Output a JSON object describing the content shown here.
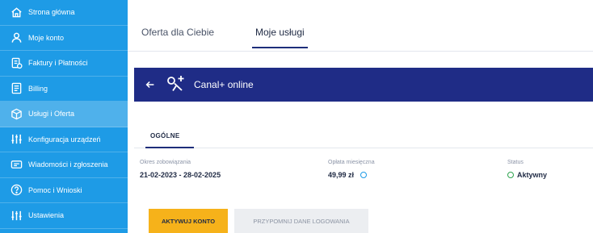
{
  "sidebar": {
    "items": [
      {
        "label": "Strona główna",
        "icon": "home-icon"
      },
      {
        "label": "Moje konto",
        "icon": "user-icon"
      },
      {
        "label": "Faktury i Płatności",
        "icon": "invoice-icon"
      },
      {
        "label": "Billing",
        "icon": "billing-icon"
      },
      {
        "label": "Usługi i Oferta",
        "icon": "services-icon"
      },
      {
        "label": "Konfiguracja urządzeń",
        "icon": "settings-sliders-icon"
      },
      {
        "label": "Wiadomości i zgłoszenia",
        "icon": "message-icon"
      },
      {
        "label": "Pomoc i Wnioski",
        "icon": "help-icon"
      },
      {
        "label": "Ustawienia",
        "icon": "settings-sliders-icon"
      }
    ],
    "active_index": 4
  },
  "tabs": {
    "offer": "Oferta dla Ciebie",
    "services": "Moje usługi"
  },
  "service": {
    "title": "Canal+ online"
  },
  "section": {
    "tab_label": "OGÓLNE"
  },
  "details": {
    "period_label": "Okres zobowiązania",
    "period_value": "21-02-2023 - 28-02-2025",
    "fee_label": "Opłata miesięczna",
    "fee_value": "49,99 zł",
    "status_label": "Status",
    "status_value": "Aktywny"
  },
  "buttons": {
    "activate": "AKTYWUJ KONTO",
    "remind": "PRZYPOMNIJ DANE LOGOWANIA"
  },
  "colors": {
    "sidebar": "#1e9be6",
    "header_bar": "#1f2c86",
    "primary_button": "#f6b21a",
    "status_active": "#2ea44f"
  }
}
